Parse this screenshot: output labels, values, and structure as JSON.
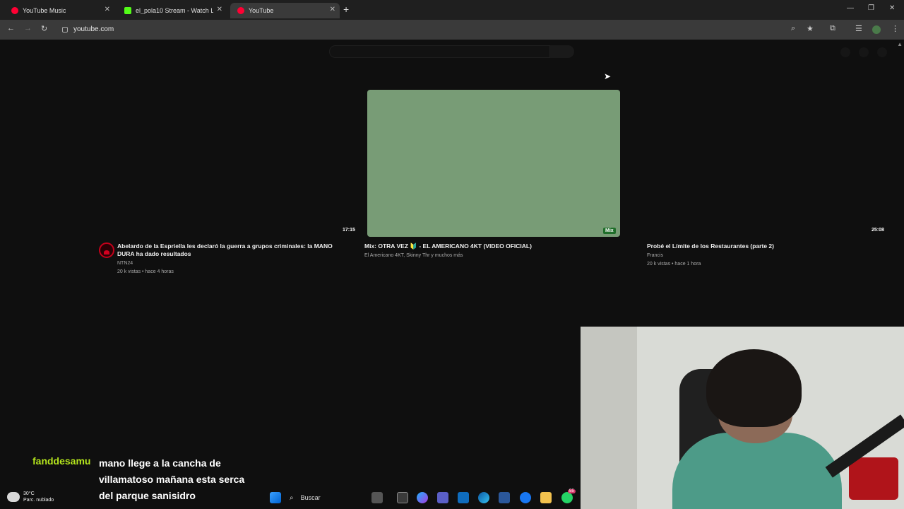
{
  "browser": {
    "tabs": [
      {
        "title": "YouTube Music",
        "color": "#ff0033",
        "active": false
      },
      {
        "title": "el_pola10 Stream - Watch Live",
        "color": "#53fc18",
        "active": false
      },
      {
        "title": "YouTube",
        "color": "#ff0033",
        "active": true
      }
    ],
    "new_tab": "+",
    "url": "youtube.com"
  },
  "videos": [
    {
      "title": "Abelardo de la Espriella les declaró la guerra a grupos criminales: la MANO DURA ha dado resultados",
      "channel": "NTN24",
      "stats": "20 k vistas • hace 4 horas",
      "duration": "17:15"
    },
    {
      "title": "Mix: OTRA VEZ 🔰 - EL AMERICANO 4KT (VIDEO OFICIAL)",
      "channel": "El Americano 4KT, Skinny Thr y muchos más",
      "stats": "",
      "badge": "Mix"
    },
    {
      "title": "Probé el Límite de los Restaurantes (parte 2)",
      "channel": "Francis",
      "stats": "20 k vistas • hace 1 hora",
      "duration": "25:08"
    }
  ],
  "stream_chat": {
    "user": "fanddesamu",
    "message": "mano llege a la cancha de villamatoso mañana esta serca del parque sanisidro"
  },
  "taskbar": {
    "temperature": "30°C",
    "weather": "Parc. nublado",
    "search": "Buscar",
    "notification_count": "55"
  },
  "colors": {
    "page_bg": "#0f0f0f",
    "thumbnail": "#789c76",
    "chat_user": "#b5e61d"
  }
}
